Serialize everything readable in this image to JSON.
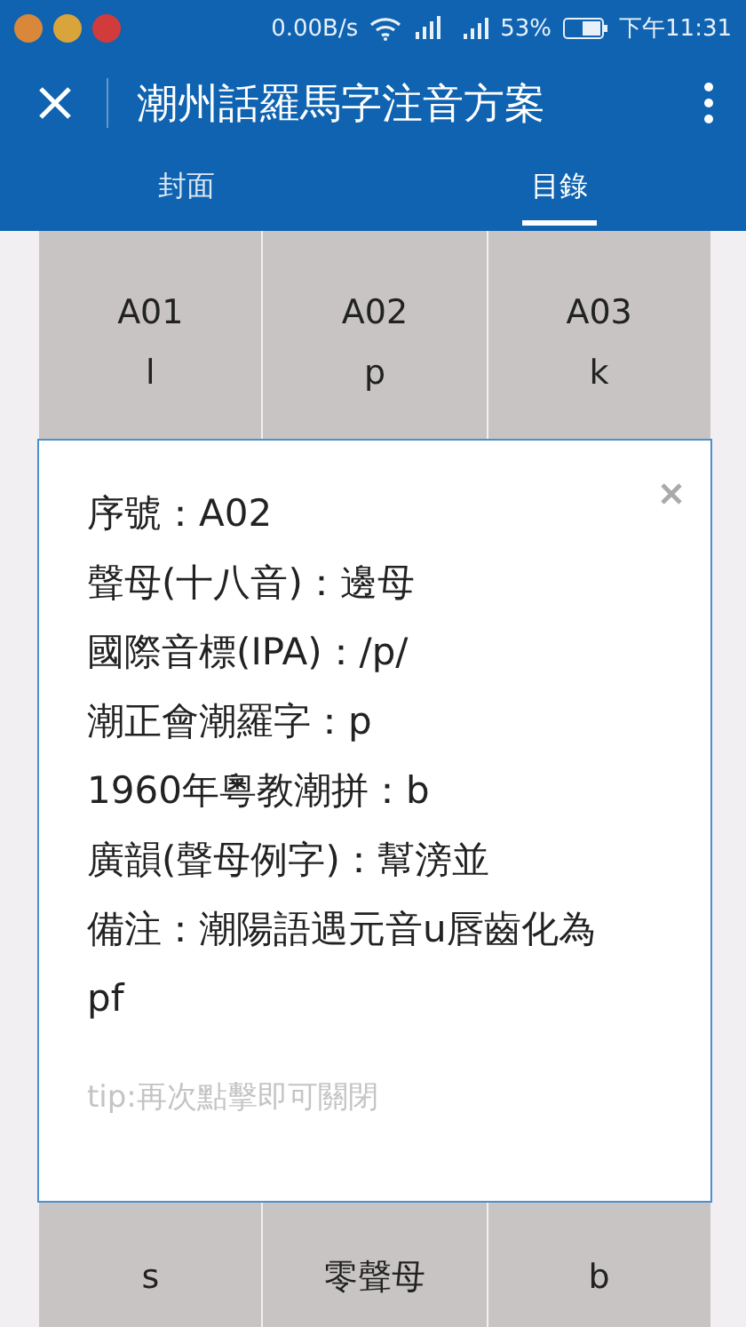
{
  "status_bar": {
    "net_speed": "0.00B/s",
    "battery": "53%",
    "time": "下午11:31"
  },
  "toolbar": {
    "title": "潮州話羅馬字注音方案"
  },
  "tabs": [
    {
      "label": "封面",
      "selected": false
    },
    {
      "label": "目錄",
      "selected": true
    }
  ],
  "grid": {
    "top_row": [
      {
        "code": "A01",
        "initial": "l"
      },
      {
        "code": "A02",
        "initial": "p"
      },
      {
        "code": "A03",
        "initial": "k"
      }
    ],
    "bottom_row": [
      {
        "initial": "s"
      },
      {
        "initial": "零聲母"
      },
      {
        "initial": "b"
      }
    ]
  },
  "dialog": {
    "lines": [
      "序號：A02",
      "聲母(十八音)：邊母",
      "國際音標(IPA)：/p/",
      "潮正會潮羅字：p",
      "1960年粵教潮拼：b",
      "廣韻(聲母例字)：幫滂並",
      "備注：潮陽語遇元音u唇齒化為pf"
    ],
    "tip": "tip:再次點擊即可關閉"
  }
}
